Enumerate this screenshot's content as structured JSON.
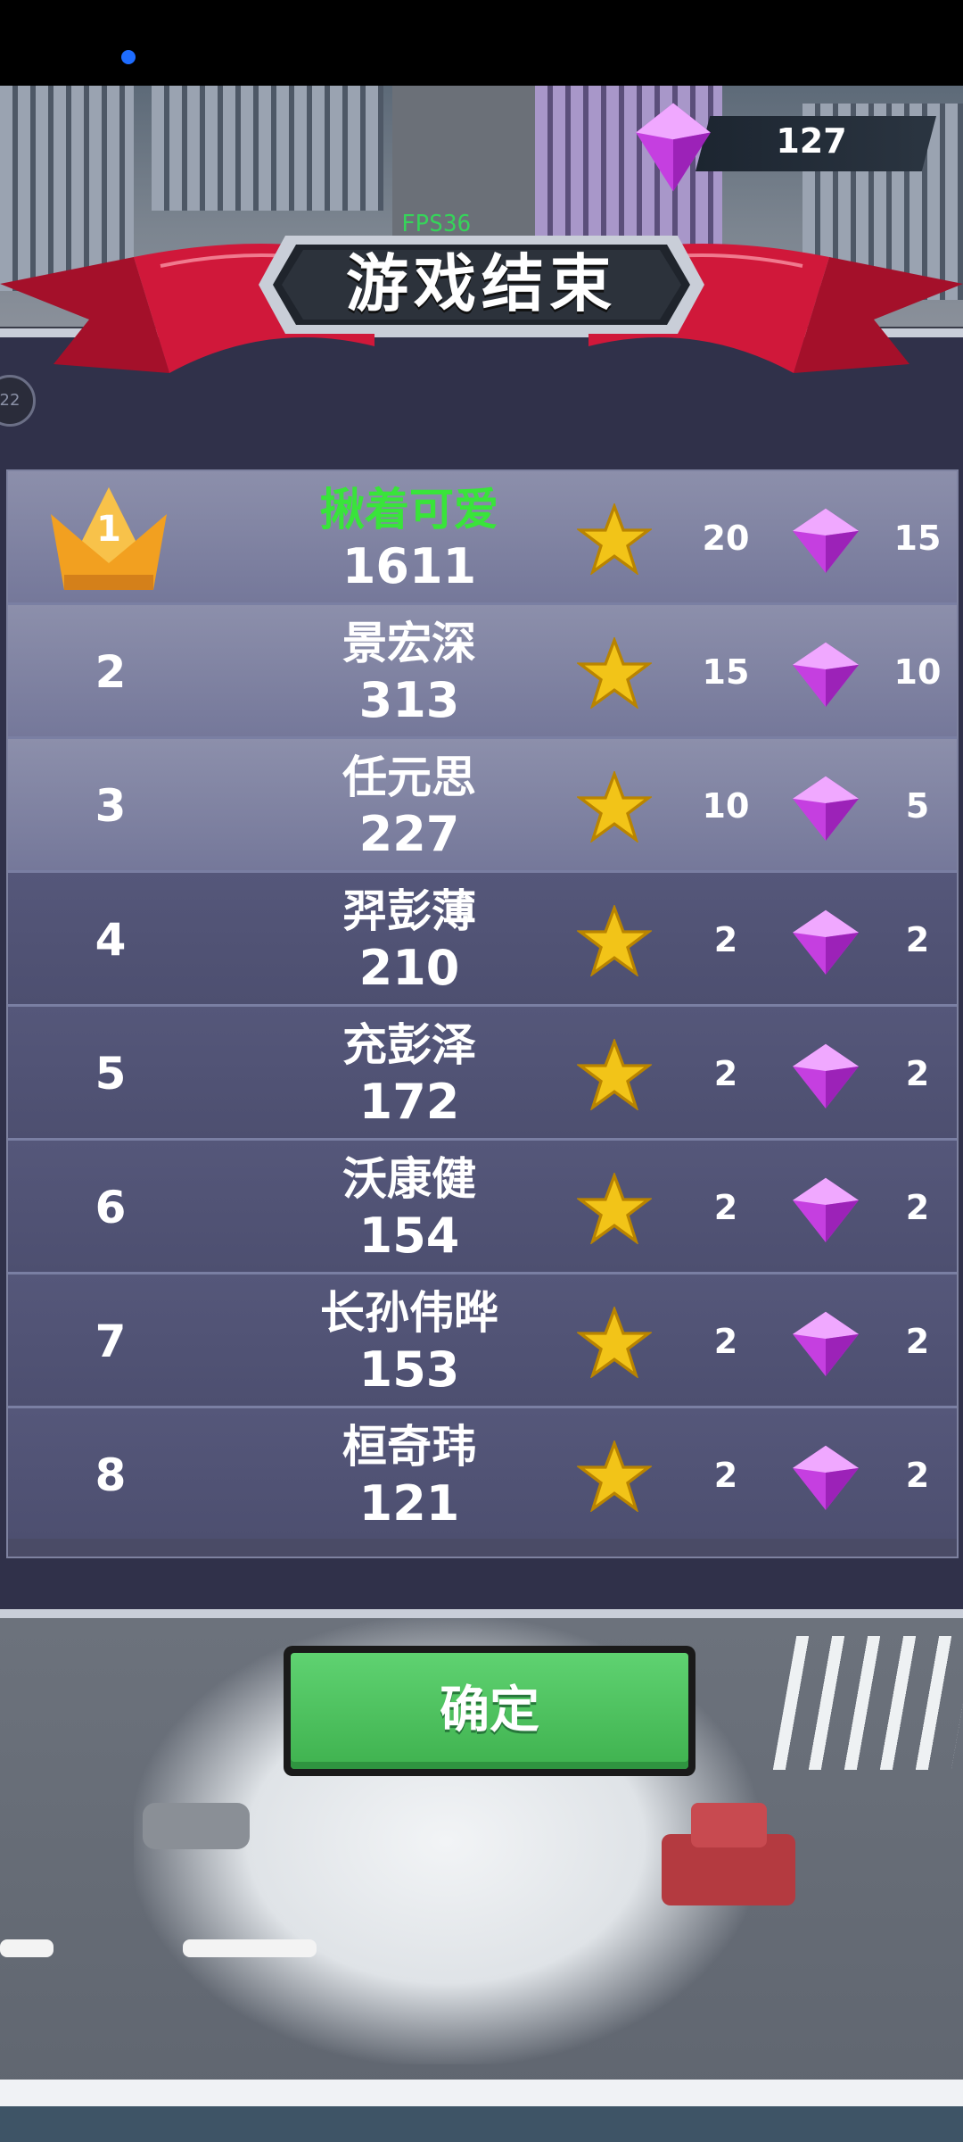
{
  "hud": {
    "gem_count": "127",
    "fps": "FPS36"
  },
  "title": "游戏结束",
  "side_badge": "22",
  "players": [
    {
      "rank": "1",
      "name": "揪着可爱",
      "score": "1611",
      "stars": "20",
      "gems": "15",
      "highlight": true
    },
    {
      "rank": "2",
      "name": "景宏深",
      "score": "313",
      "stars": "15",
      "gems": "10"
    },
    {
      "rank": "3",
      "name": "任元思",
      "score": "227",
      "stars": "10",
      "gems": "5"
    },
    {
      "rank": "4",
      "name": "羿彭薄",
      "score": "210",
      "stars": "2",
      "gems": "2"
    },
    {
      "rank": "5",
      "name": "充彭泽",
      "score": "172",
      "stars": "2",
      "gems": "2"
    },
    {
      "rank": "6",
      "name": "沃康健",
      "score": "154",
      "stars": "2",
      "gems": "2"
    },
    {
      "rank": "7",
      "name": "长孙伟晔",
      "score": "153",
      "stars": "2",
      "gems": "2"
    },
    {
      "rank": "8",
      "name": "桓奇玮",
      "score": "121",
      "stars": "2",
      "gems": "2"
    }
  ],
  "confirm_label": "确定",
  "icons": {
    "star": "star-icon",
    "gem": "gem-icon",
    "crown": "crown-icon"
  },
  "colors": {
    "highlight_name": "#39e43a",
    "confirm_button": "#4cc45e",
    "ribbon": "#d0183a"
  }
}
